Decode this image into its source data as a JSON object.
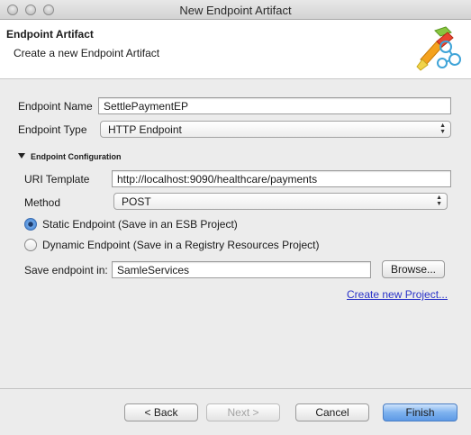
{
  "window": {
    "title": "New Endpoint Artifact"
  },
  "banner": {
    "title": "Endpoint Artifact",
    "description": "Create a new Endpoint Artifact"
  },
  "form": {
    "endpoint_name_label": "Endpoint Name",
    "endpoint_name_value": "SettlePaymentEP",
    "endpoint_type_label": "Endpoint Type",
    "endpoint_type_value": "HTTP Endpoint"
  },
  "config": {
    "section_title": "Endpoint Configuration",
    "uri_template_label": "URI Template",
    "uri_template_value": "http://localhost:9090/healthcare/payments",
    "method_label": "Method",
    "method_value": "POST",
    "static_option": "Static Endpoint (Save in an ESB Project)",
    "dynamic_option": "Dynamic Endpoint (Save in a Registry Resources Project)",
    "selected": "static",
    "save_in_label": "Save endpoint in:",
    "save_in_value": "SamleServices",
    "browse_label": "Browse...",
    "create_project_link": "Create new Project..."
  },
  "footer": {
    "back_label": "< Back",
    "next_label": "Next >",
    "cancel_label": "Cancel",
    "finish_label": "Finish"
  },
  "icons": {
    "close": "close-icon",
    "minimize": "minimize-icon",
    "maximize": "maximize-icon",
    "banner": "endpoint-wizard-icon",
    "disclosure": "disclosure-triangle-icon"
  }
}
